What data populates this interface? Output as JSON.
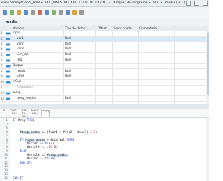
{
  "breadcrumb": {
    "items": [
      "www.tecnoplc.com_VPN",
      "PLC_MAESTRO [CPU 1214C DC/DC/DC]",
      "Bloques de programa",
      "SCL",
      "media [FC2]"
    ],
    "separator": "▸"
  },
  "block_title": "media",
  "interface": {
    "columns": [
      "Nombre",
      "Tipo de datos",
      "Offset",
      "Valor predet.",
      "Comentario"
    ],
    "rows": [
      {
        "num": "1",
        "kind": "section",
        "name": "Input",
        "dtype": ""
      },
      {
        "num": "2",
        "kind": "var",
        "name": "var1",
        "dtype": "Real"
      },
      {
        "num": "3",
        "kind": "var",
        "name": "var2",
        "dtype": "Real"
      },
      {
        "num": "4",
        "kind": "var",
        "name": "var3",
        "dtype": "Real"
      },
      {
        "num": "5",
        "kind": "var",
        "name": "Lim_Val",
        "dtype": "Real"
      },
      {
        "num": "6",
        "kind": "var",
        "name": "req",
        "dtype": "Bool"
      },
      {
        "num": "7",
        "kind": "section",
        "name": "Output",
        "dtype": ""
      },
      {
        "num": "8",
        "kind": "var",
        "name": "result",
        "dtype": "Real"
      },
      {
        "num": "9",
        "kind": "var",
        "name": "Error",
        "dtype": "Bool"
      },
      {
        "num": "10",
        "kind": "section",
        "name": "InOut",
        "dtype": ""
      },
      {
        "num": "11",
        "kind": "placeholder",
        "name": "<Agregar>",
        "dtype": ""
      },
      {
        "num": "12",
        "kind": "section",
        "name": "Temp",
        "dtype": ""
      },
      {
        "num": "13",
        "kind": "var",
        "name": "temp_media",
        "dtype": "Real"
      }
    ]
  },
  "instruction_bar": {
    "items": [
      "IF...",
      "CASE... OF...",
      "FOR... TO... DO...",
      "WHILE... DO...",
      "(*...*)"
    ]
  },
  "code_lines": [
    {
      "n": "1",
      "text": "IF #req THEN"
    },
    {
      "n": "2",
      "text": ""
    },
    {
      "n": "3",
      "text": ""
    },
    {
      "n": "4",
      "text": "    #temp_media := (#var1 + #var2 + #var3) / 3;"
    },
    {
      "n": "5",
      "text": ""
    },
    {
      "n": "6",
      "text": "    IF #temp_media > #Lim_Val THEN"
    },
    {
      "n": "7",
      "text": "        #Error := true;"
    },
    {
      "n": "8",
      "text": "        #result := -99.9;"
    },
    {
      "n": "9",
      "text": "    ELSE"
    },
    {
      "n": "10",
      "text": "        #result := #temp_media;"
    },
    {
      "n": "11",
      "text": "        #Error := false;"
    },
    {
      "n": "12",
      "text": "    END_IF;"
    },
    {
      "n": "13",
      "text": ""
    },
    {
      "n": "14",
      "text": ""
    },
    {
      "n": "15",
      "text": ""
    },
    {
      "n": "16",
      "text": "END_IF;"
    }
  ],
  "colors": {
    "accent": "#1a6fb5",
    "keyword": "#1f3fc9",
    "highlight": "#d9e6f7"
  }
}
